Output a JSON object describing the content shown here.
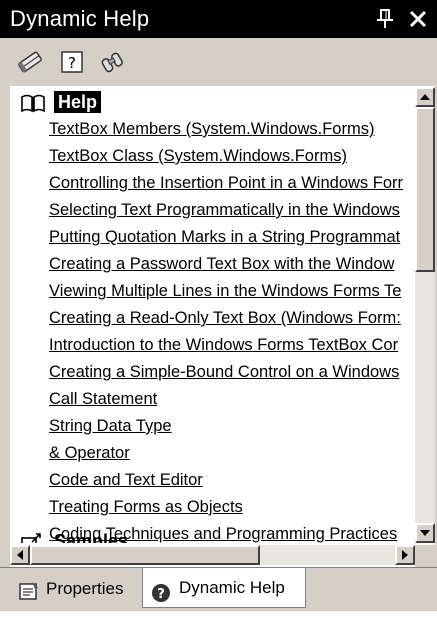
{
  "window": {
    "title": "Dynamic Help",
    "pin_glyph": "†",
    "close_glyph": "✕"
  },
  "toolbar": {
    "buttons": [
      {
        "icon": "contents-book-icon"
      },
      {
        "icon": "help-question-icon"
      },
      {
        "icon": "search-binoculars-icon"
      }
    ]
  },
  "help_section": {
    "label": "Help",
    "links": [
      "TextBox Members (System.Windows.Forms)",
      "TextBox Class (System.Windows.Forms)",
      "Controlling the Insertion Point in a Windows Forr",
      "Selecting Text Programmatically in the Windows",
      "Putting Quotation Marks in a String Programmat",
      "Creating a Password Text Box with the Window",
      "Viewing Multiple Lines in the Windows Forms Te",
      "Creating a Read-Only Text Box (Windows Form:",
      "Introduction to the Windows Forms TextBox Cor",
      "Creating a Simple-Bound Control on a Windows",
      "Call Statement",
      "String Data Type",
      "& Operator",
      "Code and Text Editor",
      "Treating Forms as Objects",
      "Coding Techniques and Programming Practices"
    ]
  },
  "samples_section": {
    "label": "Samples"
  },
  "tabs": [
    {
      "label": "Properties",
      "icon": "properties-icon",
      "active": false
    },
    {
      "label": "Dynamic Help",
      "icon": "help-circle-icon",
      "active": true
    }
  ],
  "colors": {
    "title_bg": "#000000",
    "chrome": "#d4d0c8",
    "content_bg": "#ffffff"
  }
}
